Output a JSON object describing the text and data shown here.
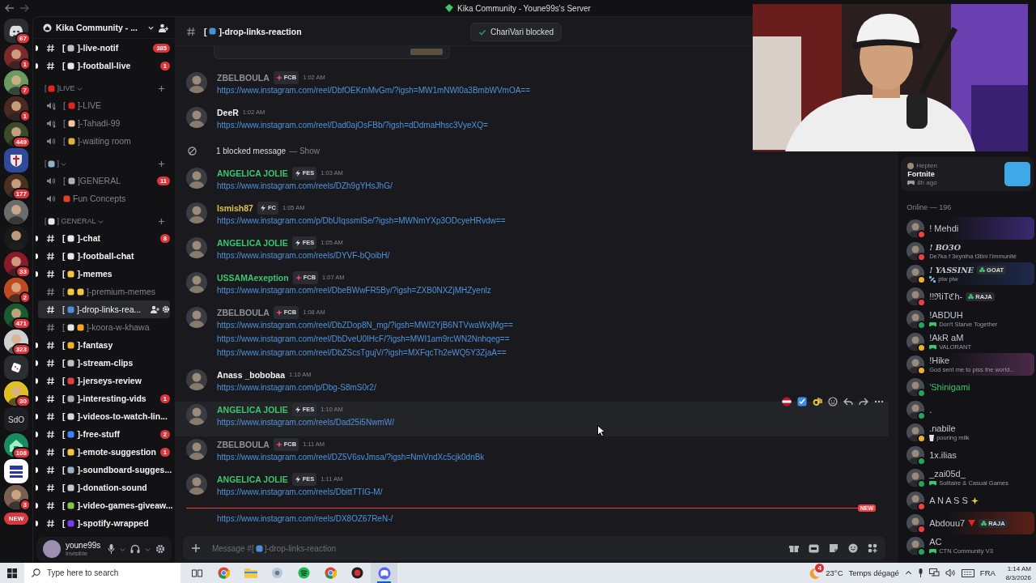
{
  "title_bar": {
    "title": "Kika Community - Youne99s's Server"
  },
  "servers": [
    {
      "kind": "home",
      "color": "#2b2d31",
      "badge": "67"
    },
    {
      "kind": "avatar",
      "color": "#7a2a2a",
      "badge": "1"
    },
    {
      "kind": "avatar",
      "color": "#6a9a60",
      "badge": "7"
    },
    {
      "kind": "avatar",
      "color": "#4a2a20",
      "badge": "1"
    },
    {
      "kind": "avatar",
      "color": "#3a4a2a",
      "badge": "449"
    },
    {
      "kind": "shield",
      "color": "#2f4a9a"
    },
    {
      "kind": "avatar",
      "color": "#4a3020",
      "badge": "177"
    },
    {
      "kind": "avatar",
      "color": "#6b6b6b"
    },
    {
      "kind": "avatar",
      "color": "#1a1a1a"
    },
    {
      "kind": "avatar",
      "color": "#8a1a2a",
      "badge": "33"
    },
    {
      "kind": "avatar",
      "color": "#c04a20",
      "badge": "2"
    },
    {
      "kind": "avatar",
      "color": "#1a5a30",
      "badge": "471"
    },
    {
      "kind": "avatar",
      "color": "#d0d0d0",
      "badge": "323"
    },
    {
      "kind": "dice",
      "color": "#2b2d31"
    },
    {
      "kind": "avatar",
      "color": "#e0c020",
      "badge": "30"
    },
    {
      "kind": "text",
      "color": "#1e1f22",
      "label": "SdO"
    },
    {
      "kind": "home_icon",
      "color": "#1a8a60",
      "badge": "108"
    },
    {
      "kind": "tile",
      "color": "#ffffff"
    },
    {
      "kind": "avatar",
      "color": "#7a6050",
      "badge": "3"
    },
    {
      "kind": "new",
      "color": "#da373c",
      "label": "NEW"
    }
  ],
  "sidebar": {
    "server_name": "Kika Community - ...",
    "channels": [
      {
        "kind": "text",
        "bracket": "[",
        "emojis": [
          {
            "color": "#c0c0c0"
          }
        ],
        "name": "]-live-notif",
        "unread": true,
        "selected": false,
        "badge": "385"
      },
      {
        "kind": "text",
        "bracket": "[",
        "emojis": [
          {
            "color": "#e8e8e8"
          }
        ],
        "name": "]-football-live",
        "unread": true,
        "selected": false,
        "badge": "1"
      },
      {
        "kind": "category",
        "bracket": "[",
        "emojis": [
          {
            "color": "#e02424"
          }
        ],
        "name": "]LIVE"
      },
      {
        "kind": "stage",
        "bracket": "[",
        "emojis": [
          {
            "color": "#e02424"
          }
        ],
        "name": "]-LIVE",
        "unread": false,
        "selected": false
      },
      {
        "kind": "stage",
        "bracket": "[",
        "emojis": [
          {
            "color": "#f0c8a0"
          }
        ],
        "name": "]-Tahadi-99",
        "unread": false,
        "selected": false
      },
      {
        "kind": "voice",
        "bracket": "[",
        "emojis": [
          {
            "color": "#e0b040"
          }
        ],
        "name": "]-waiting room",
        "unread": false,
        "selected": false
      },
      {
        "kind": "category",
        "bracket": "[",
        "emojis": [
          {
            "color": "#8fb4c8"
          }
        ],
        "name": "]"
      },
      {
        "kind": "voice",
        "bracket": "[",
        "emojis": [
          {
            "color": "#b0b0b0"
          }
        ],
        "name": "]GENERAL",
        "unread": false,
        "selected": false,
        "badge": "11"
      },
      {
        "kind": "voice",
        "emojis": [
          {
            "color": "#e0402a"
          }
        ],
        "name": "Fun Concepts",
        "unread": false,
        "selected": false
      },
      {
        "kind": "category",
        "bracket": "[",
        "emojis": [
          {
            "color": "#e8e8e8"
          }
        ],
        "name": "] GENERAL"
      },
      {
        "kind": "text",
        "bracket": "[",
        "emojis": [
          {
            "color": "#e8e8e8"
          }
        ],
        "name": "]-chat",
        "unread": true,
        "selected": false,
        "badge": "8"
      },
      {
        "kind": "text",
        "bracket": "[",
        "emojis": [
          {
            "color": "#e8e8e8"
          }
        ],
        "name": "]-football-chat",
        "unread": true,
        "selected": false
      },
      {
        "kind": "text",
        "bracket": "[",
        "emojis": [
          {
            "color": "#f5c542"
          }
        ],
        "name": "]-memes",
        "unread": true,
        "selected": false
      },
      {
        "kind": "text",
        "bracket": "[",
        "emojis": [
          {
            "color": "#f5c542"
          },
          {
            "color": "#f5c542"
          }
        ],
        "name": "]-premium-memes",
        "unread": false,
        "selected": false
      },
      {
        "kind": "text",
        "bracket": "[",
        "emojis": [
          {
            "color": "#4a90d9"
          }
        ],
        "name": "]-drop-links-rea...",
        "unread": false,
        "selected": true
      },
      {
        "kind": "text",
        "bracket": "[",
        "emojis": [
          {
            "color": "#e8e8e8"
          },
          {
            "color": "#f5a623"
          }
        ],
        "name": "]-koora-w-khawa",
        "unread": false,
        "selected": false
      },
      {
        "kind": "text",
        "bracket": "[",
        "emojis": [
          {
            "color": "#f0b030"
          }
        ],
        "name": "]-fantasy",
        "unread": true,
        "selected": false
      },
      {
        "kind": "text",
        "bracket": "[",
        "emojis": [
          {
            "color": "#c0c0c0"
          }
        ],
        "name": "]-stream-clips",
        "unread": true,
        "selected": false
      },
      {
        "kind": "text",
        "bracket": "[",
        "emojis": [
          {
            "color": "#e04040"
          }
        ],
        "name": "]-jerseys-review",
        "unread": true,
        "selected": false
      },
      {
        "kind": "text",
        "bracket": "[",
        "emojis": [
          {
            "color": "#a8a8a8"
          }
        ],
        "name": "]-interesting-vids",
        "unread": true,
        "selected": false,
        "badge": "1"
      },
      {
        "kind": "text",
        "bracket": "[",
        "emojis": [
          {
            "color": "#d8d8d8"
          }
        ],
        "name": "]-videos-to-watch-lin...",
        "unread": true,
        "selected": false
      },
      {
        "kind": "text",
        "bracket": "[",
        "emojis": [
          {
            "color": "#3b82f6"
          }
        ],
        "name": "]-free-stuff",
        "unread": true,
        "selected": false,
        "badge": "2"
      },
      {
        "kind": "text",
        "bracket": "[",
        "emojis": [
          {
            "color": "#f5c542"
          }
        ],
        "name": "]-emote-suggestion",
        "unread": true,
        "selected": false,
        "badge": "1"
      },
      {
        "kind": "text",
        "bracket": "[",
        "emojis": [
          {
            "color": "#9ab0c0"
          }
        ],
        "name": "]-soundboard-sugges...",
        "unread": true,
        "selected": false
      },
      {
        "kind": "text",
        "bracket": "[",
        "emojis": [
          {
            "color": "#c8c8c8"
          }
        ],
        "name": "]-donation-sound",
        "unread": true,
        "selected": false
      },
      {
        "kind": "text",
        "bracket": "[",
        "emojis": [
          {
            "color": "#8bc34a"
          }
        ],
        "name": "]-video-games-giveaw...",
        "unread": true,
        "selected": false
      },
      {
        "kind": "text",
        "bracket": "[",
        "emojis": [
          {
            "color": "#7c3aed"
          }
        ],
        "name": "]-spotify-wrapped",
        "unread": true,
        "selected": false
      }
    ],
    "user": {
      "name": "youne99s",
      "status": "Invisible"
    }
  },
  "chat": {
    "channel": {
      "bracket": "[",
      "color": "#4a90d9",
      "name": "]-drop-links-reaction"
    },
    "toast": "ChariVari blocked",
    "messages": [
      {
        "kind": "embed"
      },
      {
        "kind": "message",
        "author": "ZBELBOULA",
        "color": "#8e9297",
        "tag": {
          "kind": "crest",
          "text": "FCB"
        },
        "time": "1:02 AM",
        "links": [
          "https://www.instagram.com/reel/DbfOEKmMvGm/?igsh=MW1mNWl0a3BmbWVmOA=="
        ]
      },
      {
        "kind": "message",
        "author": "DeeR",
        "color": "#f2f3f5",
        "time": "1:02 AM",
        "links": [
          "https://www.instagram.com/reel/Dad0ajOsFBb/?igsh=dDdmaHhsc3VyeXQ="
        ]
      },
      {
        "kind": "blocked",
        "text": "1 blocked message",
        "action": "— Show"
      },
      {
        "kind": "message",
        "author": "ANGELICA JOLIE",
        "color": "#3ec46d",
        "tag": {
          "kind": "bolt",
          "text": "FES"
        },
        "time": "1:03 AM",
        "links": [
          "https://www.instagram.com/reels/DZh9gYHsJhG/"
        ]
      },
      {
        "kind": "message",
        "author": "Ismish87",
        "color": "#d8c04a",
        "tag": {
          "kind": "bolt",
          "text": "FC"
        },
        "time": "1:05 AM",
        "links": [
          "https://www.instagram.com/p/DbUIqssmlSe/?igsh=MWNmYXp3ODcyeHRvdw=="
        ]
      },
      {
        "kind": "message",
        "author": "ANGELICA JOLIE",
        "color": "#3ec46d",
        "tag": {
          "kind": "bolt",
          "text": "FES"
        },
        "time": "1:05 AM",
        "links": [
          "https://www.instagram.com/reels/DYVF-bQoibH/"
        ]
      },
      {
        "kind": "message",
        "author": "USSAMAexeption",
        "color": "#3ec46d",
        "tag": {
          "kind": "crest",
          "text": "FCB"
        },
        "time": "1:07 AM",
        "links": [
          "https://www.instagram.com/reel/DbeBWwFR5By/?igsh=ZXB0NXZjMHZyenlz"
        ]
      },
      {
        "kind": "message",
        "author": "ZBELBOULA",
        "color": "#8e9297",
        "tag": {
          "kind": "crest",
          "text": "FCB"
        },
        "time": "1:08 AM",
        "links": [
          "https://www.instagram.com/reel/DbZDop8N_mg/?igsh=MWI2YjB6NTVwaWxjMg==",
          "https://www.instagram.com/reel/DbDveU0IHcF/?igsh=MWI1am9rcWN2Nnhqeg==",
          "https://www.instagram.com/reel/DbZScsTgujV/?igsh=MXFqcTh2eWQ5Y3ZjaA=="
        ]
      },
      {
        "kind": "message",
        "author": "Anass _bobobaa",
        "color": "#f2f3f5",
        "time": "1:10 AM",
        "links": [
          "https://www.instagram.com/p/Dbg-S8mS0r2/"
        ]
      },
      {
        "kind": "message",
        "author": "ANGELICA JOLIE",
        "color": "#3ec46d",
        "tag": {
          "kind": "bolt",
          "text": "FES"
        },
        "time": "1:10 AM",
        "hovered": true,
        "links": [
          "https://www.instagram.com/reels/Dad25i5NwmW/"
        ]
      },
      {
        "kind": "message",
        "author": "ZBELBOULA",
        "color": "#8e9297",
        "tag": {
          "kind": "crest",
          "text": "FCB"
        },
        "time": "1:11 AM",
        "links": [
          "https://www.instagram.com/reel/DZ5V6svJmsa/?igsh=NmVndXc5cjk0dnBk"
        ]
      },
      {
        "kind": "message",
        "author": "ANGELICA JOLIE",
        "color": "#3ec46d",
        "tag": {
          "kind": "bolt",
          "text": "FES"
        },
        "time": "1:11 AM",
        "links": [
          "https://www.instagram.com/reels/DbittTTIG-M/"
        ]
      },
      {
        "kind": "divider",
        "label": "NEW"
      },
      {
        "kind": "continuation",
        "links": [
          "https://www.instagram.com/reels/DX8OZ67ReN-/"
        ]
      }
    ],
    "composer": {
      "placeholder_start": "Message #[",
      "color": "#4a90d9",
      "placeholder_end": "]-drop-links-reaction"
    }
  },
  "members": {
    "activity": {
      "user": "Hepten",
      "game": "Fortnite",
      "time": "8h ago"
    },
    "heading": "Online — 196",
    "list": [
      {
        "name": "! Mehdi",
        "color": "#c4c9d0",
        "status": {
          "color": "#f23f43"
        },
        "banner": {
          "color": "#3a2870"
        }
      },
      {
        "name": "! BO3O",
        "color": "#c4c9d0",
        "status": {
          "color": "#f23f43"
        },
        "fancy": true,
        "subtitle": {
          "kind": "plain",
          "text": "De7ka f 3eyniha t3tini l'immunité"
        }
      },
      {
        "name": "! YASSINE",
        "color": "#c4c9d0",
        "status": {
          "color": "#f0b232"
        },
        "fancy": true,
        "tag": "GOAT",
        "subtitle": {
          "kind": "custom",
          "text": "piw piw"
        },
        "banner": {
          "color": "#1e2a4a"
        }
      },
      {
        "name": "!!ℜiTℭh-",
        "color": "#c4c9d0",
        "status": {
          "color": "#f23f43"
        },
        "tag": "RAJA"
      },
      {
        "name": "!ABDUH",
        "color": "#c4c9d0",
        "status": {
          "color": "#23a55a"
        },
        "subtitle": {
          "kind": "game",
          "text": "Don't Starve Together"
        }
      },
      {
        "name": "!AkR aM",
        "color": "#c4c9d0",
        "status": {
          "color": "#f0b232"
        },
        "subtitle": {
          "kind": "game",
          "text": "VALORANT"
        }
      },
      {
        "name": "!Hike",
        "color": "#c4c9d0",
        "status": {
          "color": "#f0b232"
        },
        "subtitle": {
          "kind": "plain",
          "text": "God sent me to piss the world..."
        },
        "banner": {
          "color": "#4a2a4a"
        }
      },
      {
        "name": "'Shinigami",
        "color": "#3ec46d",
        "status": {
          "color": "#23a55a"
        }
      },
      {
        "name": ".",
        "status": {
          "color": "#23a55a"
        }
      },
      {
        "name": ".nabile",
        "color": "#c4c9d0",
        "status": {
          "color": "#f0b232"
        },
        "subtitle": {
          "kind": "drink",
          "text": "pouring milk"
        }
      },
      {
        "name": "1x.ilias",
        "color": "#c4c9d0",
        "status": {
          "color": "#23a55a"
        }
      },
      {
        "name": "_zai05d_",
        "color": "#c4c9d0",
        "status": {
          "color": "#23a55a"
        },
        "subtitle": {
          "kind": "game",
          "text": "Solitaire & Casual Games"
        }
      },
      {
        "name": "A N A S S",
        "color": "#c4c9d0",
        "status": {
          "color": "#f23f43"
        },
        "decor": {
          "kind": "sparkle"
        }
      },
      {
        "name": "Abdouu7",
        "color": "#c4c9d0",
        "status": {
          "color": "#f23f43"
        },
        "decor": {
          "kind": "triangle"
        },
        "tag": "RAJA",
        "banner": {
          "color": "#5a2018"
        }
      },
      {
        "name": "AC",
        "color": "#c4c9d0",
        "status": {
          "color": "#23a55a"
        },
        "subtitle": {
          "kind": "game",
          "text": "CTN Community V3"
        }
      }
    ]
  },
  "taskbar": {
    "search_placeholder": "Type here to search",
    "apps": [
      {
        "kind": "taskview",
        "active": false
      },
      {
        "kind": "chrome",
        "active": false
      },
      {
        "kind": "folder",
        "active": false
      },
      {
        "kind": "app",
        "active": false
      },
      {
        "kind": "spotify",
        "active": false
      },
      {
        "kind": "chrome",
        "active": false
      },
      {
        "kind": "app2",
        "active": false
      },
      {
        "kind": "discord",
        "active": true
      }
    ],
    "weather_badge": "4",
    "temperature": "23°C",
    "weather": "Temps dégagé",
    "language": "FRA",
    "time": "1:14 AM",
    "date": "8/3/2026"
  }
}
